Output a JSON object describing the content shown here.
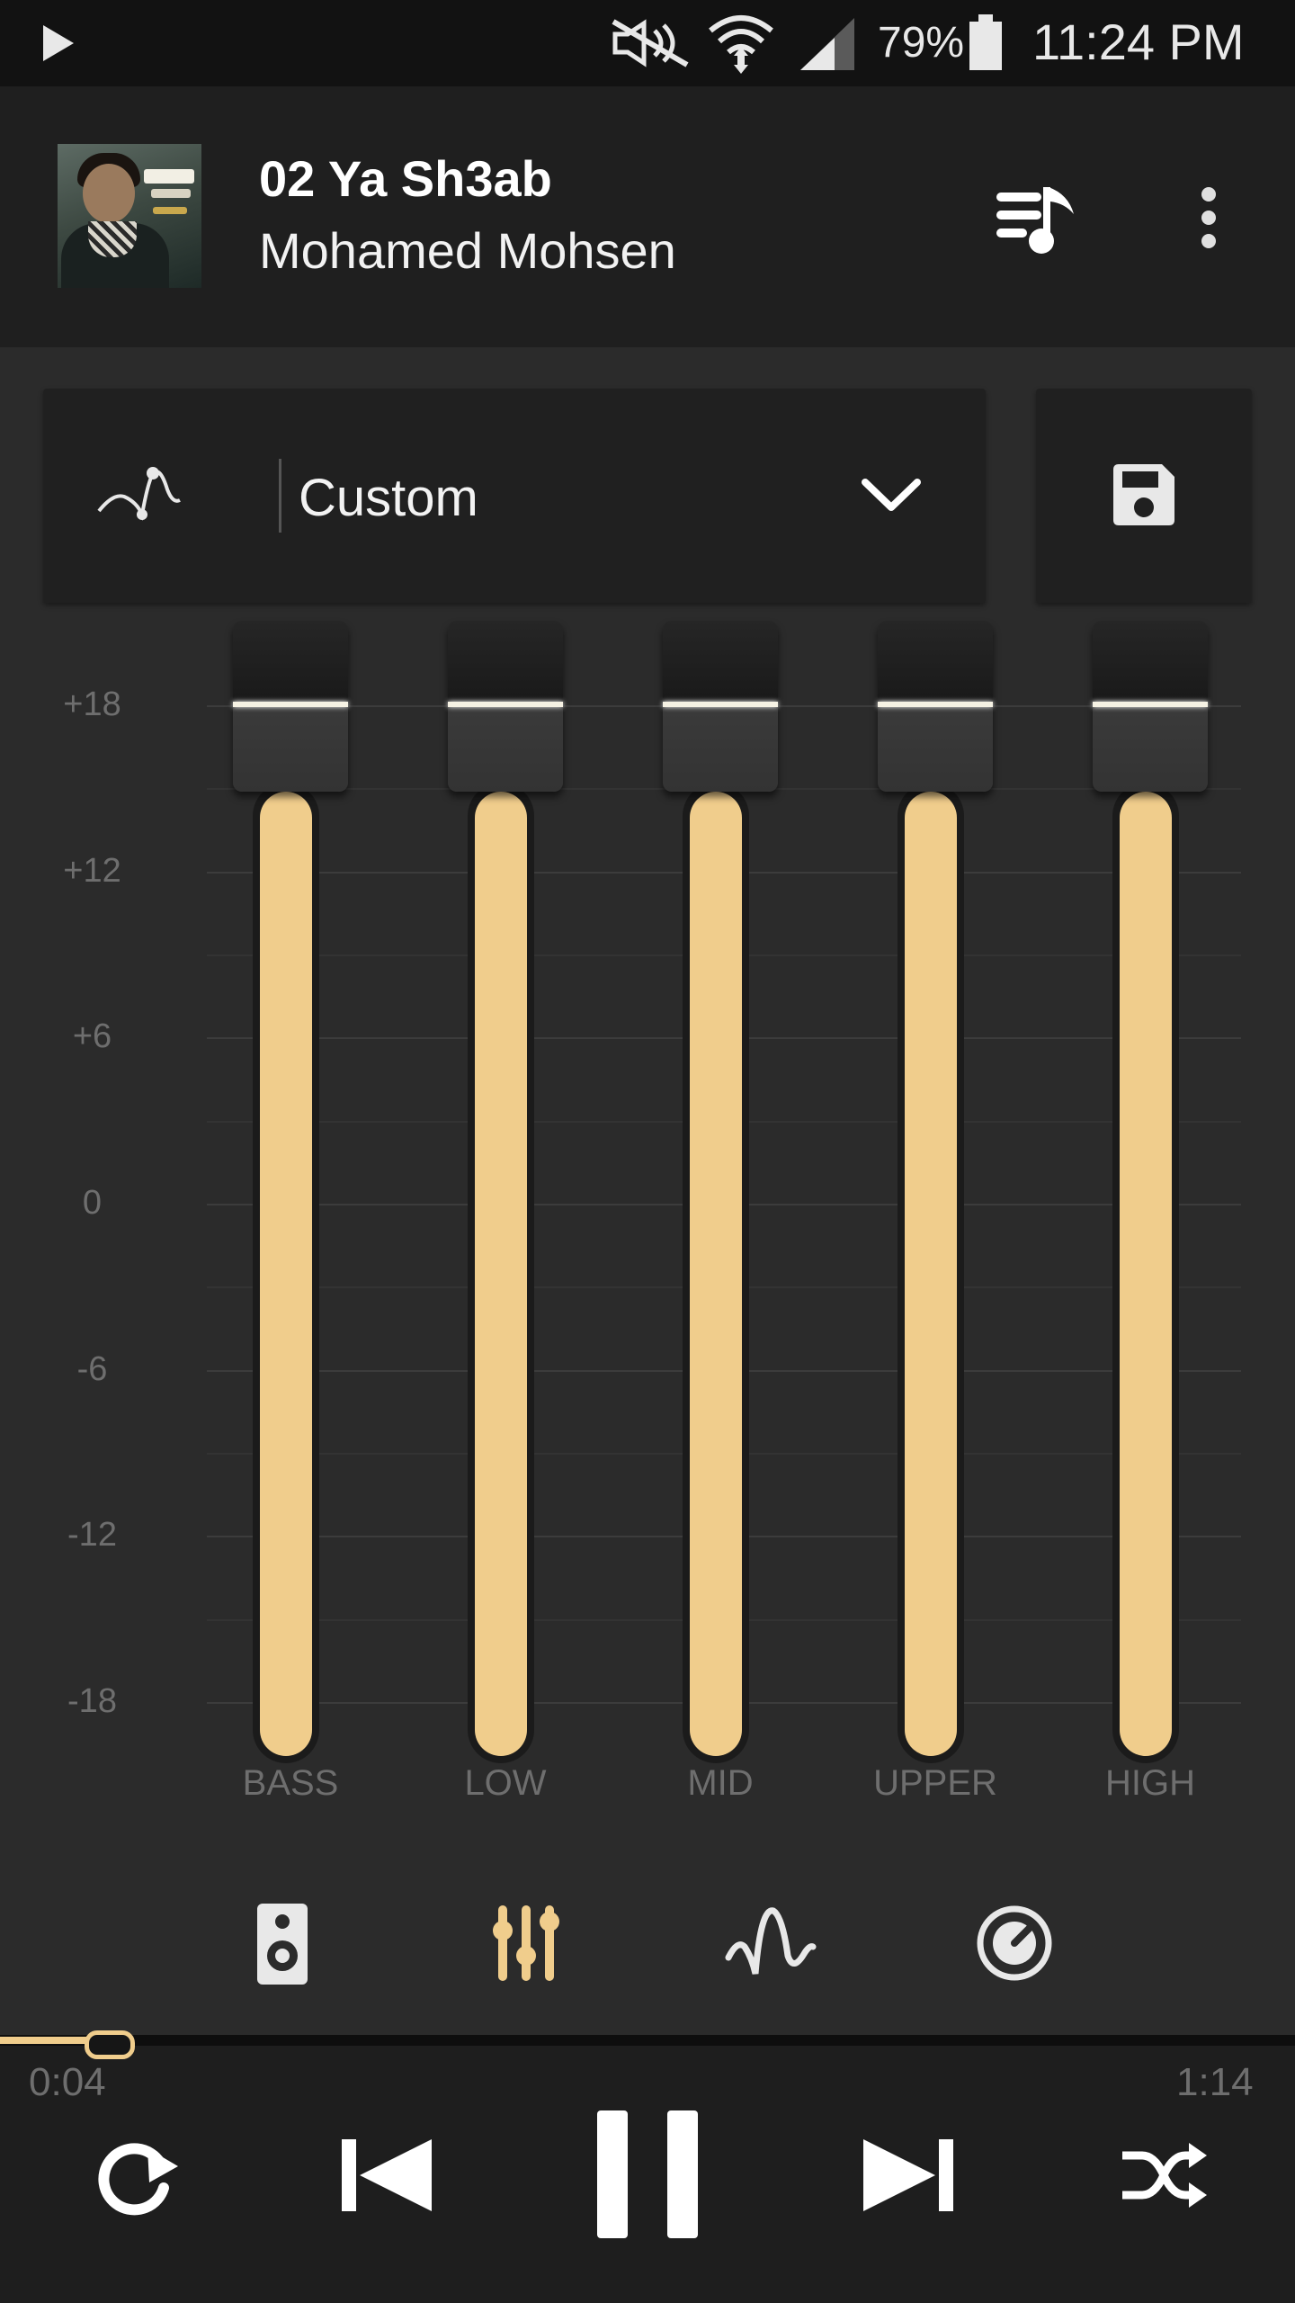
{
  "status_bar": {
    "battery": "79%",
    "time": "11:24 PM",
    "icons": [
      "play-icon",
      "mute-icon",
      "wifi-icon",
      "signal-icon",
      "battery-icon"
    ]
  },
  "now_playing": {
    "title": "02 Ya Sh3ab",
    "artist": "Mohamed Mohsen",
    "icons": [
      "queue-music-icon",
      "more-vert-icon"
    ]
  },
  "preset": {
    "label": "Custom",
    "icons": [
      "preset-wave-icon",
      "chevron-down-icon",
      "save-icon"
    ]
  },
  "eq": {
    "db_labels": [
      "+18",
      "+12",
      "+6",
      "0",
      "-6",
      "-12",
      "-18"
    ],
    "bands": [
      {
        "label": "BASS",
        "value_db": 18
      },
      {
        "label": "LOW",
        "value_db": 18
      },
      {
        "label": "MID",
        "value_db": 18
      },
      {
        "label": "UPPER",
        "value_db": 18
      },
      {
        "label": "HIGH",
        "value_db": 18
      }
    ]
  },
  "tabs": [
    {
      "name": "speaker-icon",
      "active": false
    },
    {
      "name": "equalizer-icon",
      "active": true
    },
    {
      "name": "wave-icon",
      "active": false
    },
    {
      "name": "knob-icon",
      "active": false
    }
  ],
  "playback": {
    "current_time": "0:04",
    "total_time": "1:14",
    "progress": 0.054,
    "icons": [
      "repeat-icon",
      "previous-icon",
      "pause-icon",
      "next-icon",
      "shuffle-icon"
    ]
  },
  "colors": {
    "accent": "#f0cd8c",
    "background": "#2b2b2b",
    "header": "#1f1f1f"
  }
}
